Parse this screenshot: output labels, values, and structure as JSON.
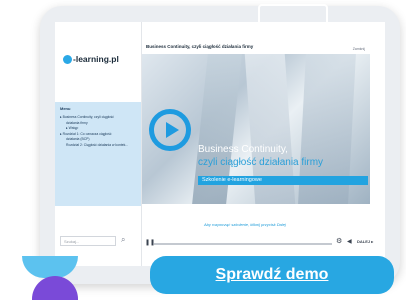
{
  "course_title": "Business Continuity, czyli ciągłość działania firmy",
  "top_right_label": "Zamknij",
  "logo": {
    "text": "-learning.pl"
  },
  "menu": {
    "title": "Menu",
    "items": [
      {
        "label": "▸ Business Continuity, czyli ciągłość",
        "sub": false
      },
      {
        "label": "działania firmy",
        "sub": true
      },
      {
        "label": "▸ Wstęp",
        "sub": true
      },
      {
        "label": "▸ Rozdział 1: Co oznacza ciągłość",
        "sub": false
      },
      {
        "label": "działania (BCP)",
        "sub": true
      },
      {
        "label": "Rozdział 2: Ciągłość działania w kontek...",
        "sub": true
      }
    ]
  },
  "search": {
    "placeholder": "Szukaj..."
  },
  "slide": {
    "title_line1": "Business Continuity,",
    "title_line2": "czyli ciągłość działania firmy",
    "subtitle": "Szkolenie e-learningowe"
  },
  "resume_text": "Aby rozpocząć szkolenie, kliknij przycisk Dalej",
  "player": {
    "progress": 0.0,
    "next_label": "DALEJ ▸"
  },
  "cta": {
    "label": "Sprawdź demo"
  },
  "colors": {
    "accent": "#28a7e2",
    "purple": "#7a4ad8"
  }
}
